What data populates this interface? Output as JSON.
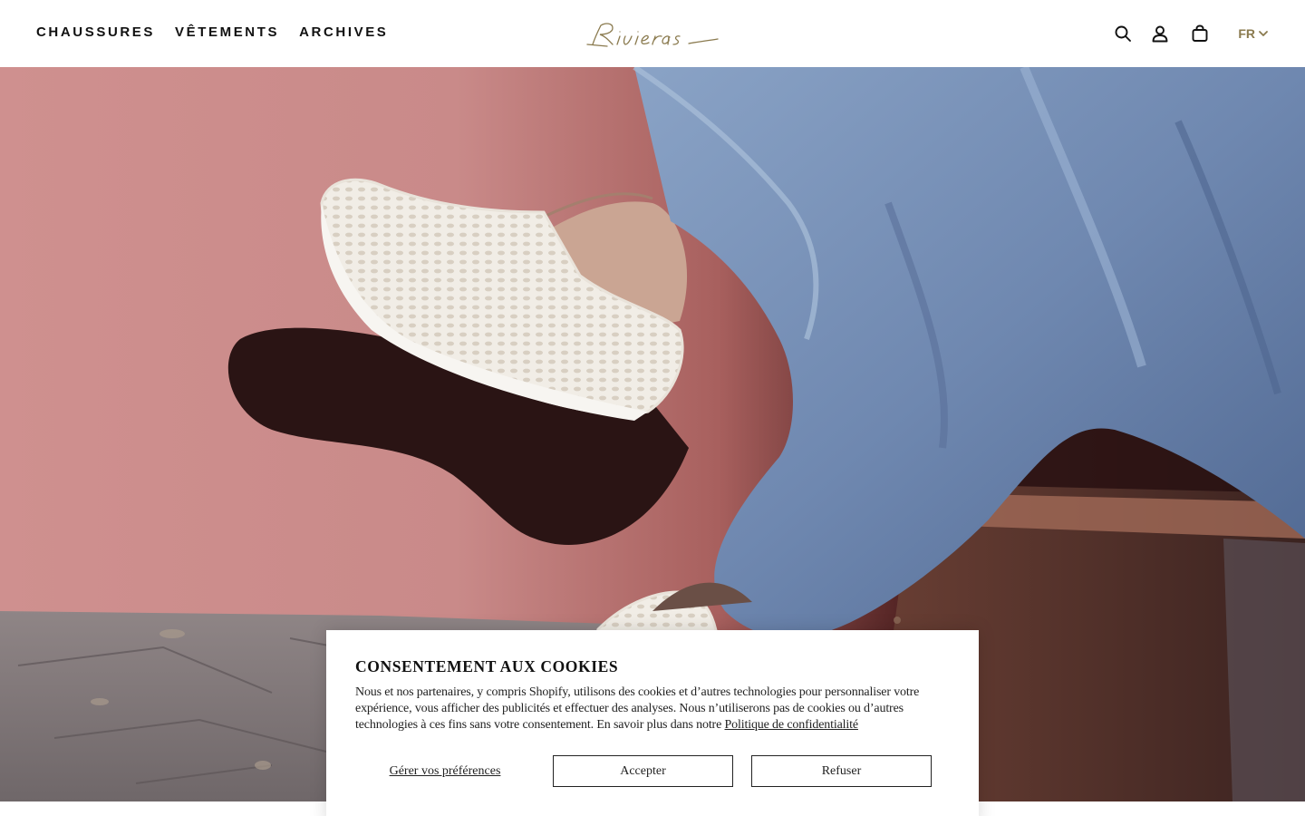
{
  "header": {
    "nav": [
      "CHAUSSURES",
      "VÊTEMENTS",
      "ARCHIVES"
    ],
    "logo_text": "Rivieras",
    "language": "FR"
  },
  "icons": {
    "search": "search-icon",
    "account": "user-icon",
    "cart": "shopping-bag-icon",
    "language": "chevron-down-icon"
  },
  "colors": {
    "logo_gold": "#8a7a4e",
    "wall_pink": "#c98e8c",
    "trousers_blue": "#6d86ad"
  },
  "cookie": {
    "title": "CONSENTEMENT AUX COOKIES",
    "text": "Nous et nos partenaires, y compris Shopify, utilisons des cookies et d’autres technologies pour personnaliser votre expérience, vous afficher des publicités et effectuer des analyses. Nous n’utiliserons pas de cookies ou d’autres technologies à ces fins sans votre consentement. En savoir plus dans notre",
    "policy_link": "Politique de confidentialité",
    "manage": "Gérer vos préférences",
    "accept": "Accepter",
    "decline": "Refuser"
  }
}
